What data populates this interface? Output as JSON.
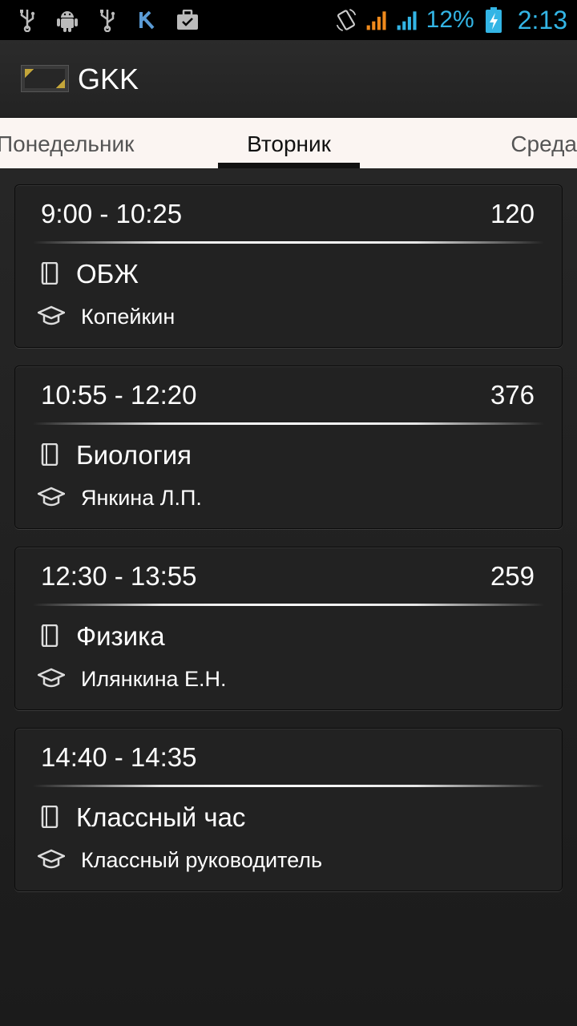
{
  "status_bar": {
    "battery_percent": "12%",
    "time": "2:13",
    "left_icons": [
      "usb-icon",
      "android-debug-icon",
      "usb-icon",
      "vk-icon",
      "briefcase-icon"
    ],
    "right_icons": [
      "rotate-icon",
      "signal-orange-icon",
      "signal-blue-icon",
      "battery-charging-icon"
    ],
    "accent_color": "#33b5e5"
  },
  "action_bar": {
    "title": "GKK"
  },
  "tabs": {
    "prev": "Понедельник",
    "current": "Вторник",
    "next": "Среда"
  },
  "lessons": [
    {
      "time": "9:00 - 10:25",
      "room": "120",
      "subject": "ОБЖ",
      "teacher": "Копейкин"
    },
    {
      "time": "10:55 - 12:20",
      "room": "376",
      "subject": "Биология",
      "teacher": "Янкина Л.П."
    },
    {
      "time": "12:30 - 13:55",
      "room": "259",
      "subject": "Физика",
      "teacher": "Илянкина Е.Н."
    },
    {
      "time": "14:40 - 14:35",
      "room": "",
      "subject": "Классный час",
      "teacher": "Классный руководитель"
    }
  ]
}
